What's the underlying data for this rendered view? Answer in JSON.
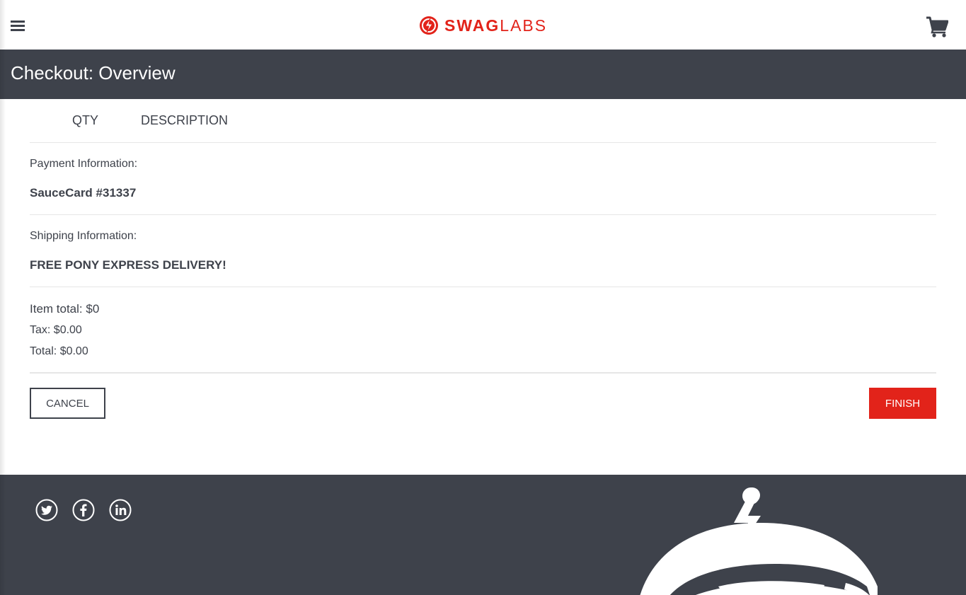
{
  "header": {
    "logo": {
      "bold": "SWAG",
      "light": "LABS"
    },
    "menu_icon": "hamburger-menu-icon",
    "cart_icon": "shopping-cart-icon"
  },
  "page": {
    "title": "Checkout: Overview"
  },
  "list": {
    "qty_header": "QTY",
    "description_header": "DESCRIPTION"
  },
  "payment": {
    "label": "Payment Information:",
    "value": "SauceCard #31337"
  },
  "shipping": {
    "label": "Shipping Information:",
    "value": "FREE PONY EXPRESS DELIVERY!"
  },
  "summary": {
    "subtotal": "Item total: $0",
    "tax": "Tax: $0.00",
    "total": "Total: $0.00"
  },
  "actions": {
    "cancel_label": "CANCEL",
    "finish_label": "FINISH"
  },
  "footer": {
    "social": [
      "twitter-icon",
      "facebook-icon",
      "linkedin-icon"
    ],
    "mascot": "swag-bot-robot-icon"
  },
  "colors": {
    "brand_red": "#e2231a",
    "dark_slate": "#3e424b",
    "divider": "#e6e6e6"
  }
}
